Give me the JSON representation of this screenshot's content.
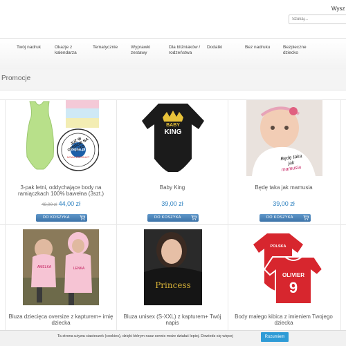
{
  "header": {
    "top_link": "Wysz",
    "search_placeholder": "Szukaj..."
  },
  "nav": {
    "items": [
      {
        "label": "Twój nadruk"
      },
      {
        "label": "Okazje z kalendarza"
      },
      {
        "label": "Tematycznie"
      },
      {
        "label": "Wyprawki zestawy"
      },
      {
        "label": "Dla bliźniaków / rodzeństwa"
      },
      {
        "label": "Dodatki"
      },
      {
        "label": "Bez nadruku"
      },
      {
        "label": "Bezpieczne dziecko"
      }
    ]
  },
  "page": {
    "title": "Promocje"
  },
  "products": [
    {
      "name": "3-pak letni, oddychające body na ramiączkach 100% bawełna (3szt.)",
      "old_price": "49,00 zł",
      "price": "44,00 zł",
      "cart_label": "DO KOSZYKA",
      "image_icon": "tank-bodysuits-3pack",
      "badge_text": "JUŻ W OFERCIE NA LATO",
      "brand": "dejna.pl",
      "badge_sub": "NOWA PRODUKT"
    },
    {
      "name": "Baby King",
      "price": "39,00 zł",
      "cart_label": "DO KOSZYKA",
      "image_icon": "black-bodysuit-crown",
      "print_line1": "BABY",
      "print_line2": "KING"
    },
    {
      "name": "Będę taka jak mamusia",
      "price": "39,00 zł",
      "cart_label": "DO KOSZYKA",
      "image_icon": "baby-photo",
      "print_line1": "Będę taka",
      "print_line2": "jak",
      "print_line3": "mamusia"
    },
    {
      "name": "Bluza dziecięca oversize z kapturem+ imię dziecka",
      "image_icon": "pink-hoodies-photo",
      "print_line1": "AMELKA",
      "print_line2": "LENKA"
    },
    {
      "name": "Bluza unisex (S-XXL) z kapturem+ Twój napis",
      "image_icon": "black-hoodie-photo",
      "print_line1": "Princess"
    },
    {
      "name": "Body małego kibica z imieniem Twojego dziecka",
      "image_icon": "red-football-kit",
      "print_line1": "POLSKA",
      "print_line2": "OLIVIER",
      "print_line3": "9"
    }
  ],
  "cookie": {
    "text": "Ta strona używa ciasteczek (cookies), dzięki którym nasz serwis może działać lepiej. Dowiedz się więcej",
    "button": "Rozumiem"
  },
  "colors": {
    "price": "#2a7fbf",
    "cart_button": "#3c73a8",
    "cookie_button": "#2e9bd6"
  }
}
